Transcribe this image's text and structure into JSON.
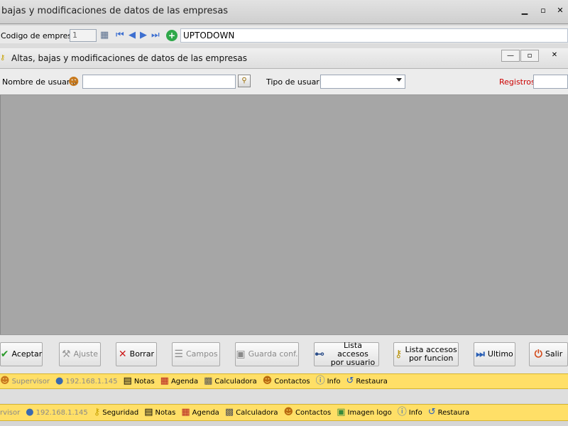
{
  "outer_window": {
    "title": "bajas y modificaciones de datos de las empresas",
    "controls": {
      "minimize": "▁",
      "maximize": "▫",
      "close": "✕"
    }
  },
  "company_bar": {
    "codigo_label": "Codigo  de empresa",
    "codigo_value": "1",
    "company_name": "UPTODOWN"
  },
  "inner_window": {
    "title": "Altas, bajas y modificaciones de datos de las empresas",
    "controls": {
      "minimize": "—",
      "restore": "▫",
      "close": "✕"
    }
  },
  "filters": {
    "nombre_label": "Nombre de usuario",
    "nombre_value": "",
    "tipo_label": "Tipo de usuario",
    "tipo_value": "",
    "registros_label": "Registros",
    "registros_value": ""
  },
  "buttons": [
    {
      "id": "aceptar",
      "label": "Aceptar",
      "icon": "check-icon"
    },
    {
      "id": "ajuste",
      "label": "Ajuste",
      "icon": "wrench-icon"
    },
    {
      "id": "borrar",
      "label": "Borrar",
      "icon": "x-icon"
    },
    {
      "id": "campos",
      "label": "Campos",
      "icon": "list-icon"
    },
    {
      "id": "guarda",
      "label": "Guarda conf.",
      "icon": "floppy-icon"
    },
    {
      "id": "lista_usuario",
      "label1": "Lista accesos",
      "label2": "por usuario",
      "icon": "binoculars-icon"
    },
    {
      "id": "lista_funcion",
      "label1": "Lista accesos",
      "label2": "por funcion",
      "icon": "keys-icon"
    },
    {
      "id": "ultimo",
      "label": "Ultimo",
      "icon": "next-icon"
    },
    {
      "id": "salir",
      "label": "Salir",
      "icon": "power-icon"
    }
  ],
  "status_inner": {
    "user": "Supervisor",
    "ip": "192.168.1.145",
    "notas": "Notas",
    "agenda": "Agenda",
    "calculadora": "Calculadora",
    "contactos": "Contactos",
    "info": "Info",
    "restaura": "Restaura"
  },
  "status_outer": {
    "user": "rvisor",
    "ip": "192.168.1.145",
    "seguridad": "Seguridad",
    "notas": "Notas",
    "agenda": "Agenda",
    "calculadora": "Calculadora",
    "contactos": "Contactos",
    "imagen_logo": "Imagen logo",
    "info": "Info",
    "restaura": "Restaura"
  },
  "colors": {
    "status_bg": "#ffdf67",
    "content_bg": "#a6a6a6",
    "registros": "#cc0000"
  }
}
